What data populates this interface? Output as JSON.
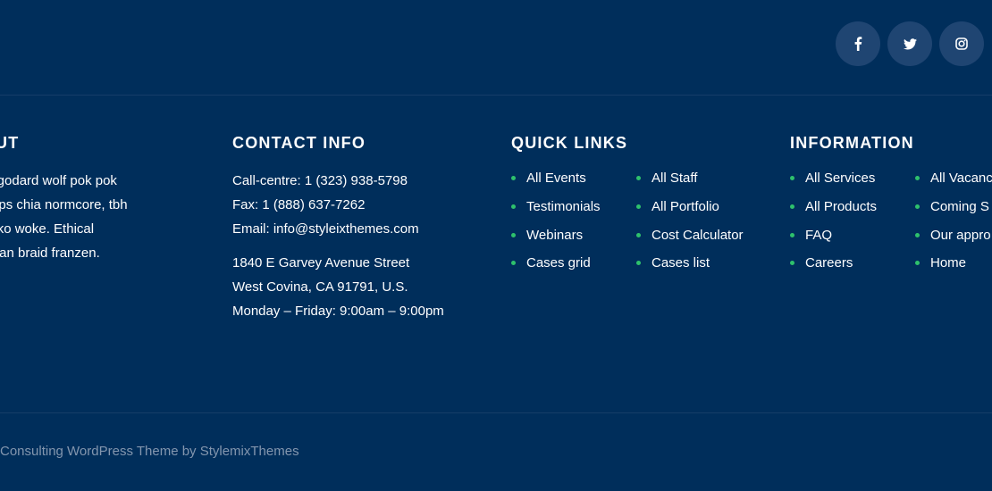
{
  "social": [
    {
      "name": "facebook",
      "icon": "facebook-icon"
    },
    {
      "name": "twitter",
      "icon": "twitter-icon"
    },
    {
      "name": "instagram",
      "icon": "instagram-icon"
    }
  ],
  "about": {
    "title": "UT",
    "lines": [
      "rtorial godard wolf pok pok",
      "ale chips chia normcore, tbh",
      " four loko woke. Ethical",
      "own man braid franzen."
    ]
  },
  "contact": {
    "title": "CONTACT INFO",
    "phone": "Call-centre: 1 (323) 938-5798",
    "fax": "Fax: 1 (888) 637-7262",
    "email": "Email: info@styleixthemes.com",
    "address1": "1840 E Garvey Avenue Street",
    "address2": "West Covina, CA 91791, U.S.",
    "hours": "Monday – Friday: 9:00am – 9:00pm"
  },
  "quick_links": {
    "title": "QUICK LINKS",
    "items": [
      "All Events",
      "All Staff",
      "Testimonials",
      "All Portfolio",
      "Webinars",
      "Cost Calculator",
      "Cases grid",
      "Cases list"
    ]
  },
  "information": {
    "title": "INFORMATION",
    "items": [
      "All Services",
      "All Vacanc",
      "All Products",
      "Coming S",
      "FAQ",
      "Our appro",
      "Careers",
      "Home"
    ]
  },
  "copyright": "Consulting WordPress Theme by StylemixThemes",
  "colors": {
    "background": "#002e5b",
    "accent": "#2ec16c",
    "social_bg": "#1f4572",
    "muted_text": "#8396ae"
  }
}
